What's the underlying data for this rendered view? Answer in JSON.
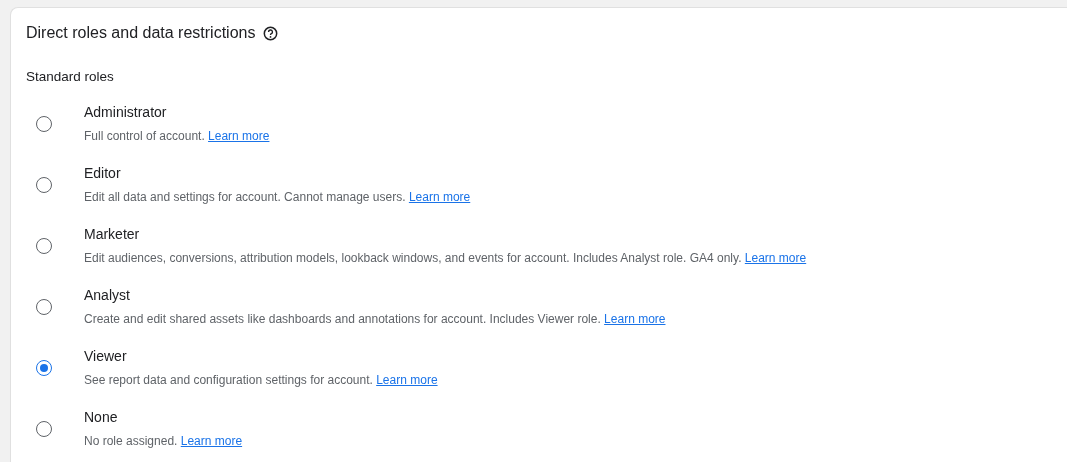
{
  "section": {
    "title": "Direct roles and data restrictions",
    "subtitle": "Standard roles"
  },
  "roles": [
    {
      "name": "Administrator",
      "description": "Full control of account.",
      "link": "Learn more",
      "selected": false
    },
    {
      "name": "Editor",
      "description": "Edit all data and settings for account. Cannot manage users.",
      "link": "Learn more",
      "selected": false
    },
    {
      "name": "Marketer",
      "description": "Edit audiences, conversions, attribution models, lookback windows, and events for account. Includes Analyst role. GA4 only.",
      "link": "Learn more",
      "selected": false
    },
    {
      "name": "Analyst",
      "description": "Create and edit shared assets like dashboards and annotations for account. Includes Viewer role.",
      "link": "Learn more",
      "selected": false
    },
    {
      "name": "Viewer",
      "description": "See report data and configuration settings for account.",
      "link": "Learn more",
      "selected": true
    },
    {
      "name": "None",
      "description": "No role assigned.",
      "link": "Learn more",
      "selected": false
    }
  ]
}
